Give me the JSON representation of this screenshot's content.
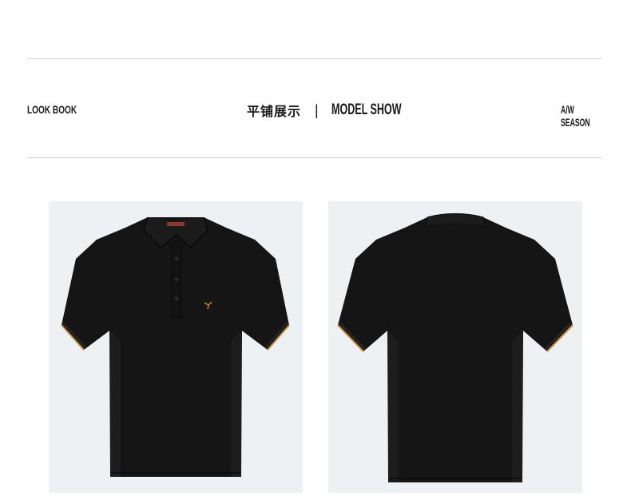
{
  "header": {
    "left_label": "LOOK BOOK",
    "center_label_zh": "平铺展示",
    "separator": "|",
    "center_label_en": "MODEL SHOW",
    "right_label": "A/W SEASON"
  },
  "gallery": {
    "items": [
      {
        "view": "front",
        "garment": "black polo shirt"
      },
      {
        "view": "back",
        "garment": "black polo shirt"
      }
    ]
  },
  "colors": {
    "background": "#ffffff",
    "rule": "#cfcfcf",
    "text": "#1a1a1a",
    "photo_bg": "#eef1f4",
    "shirt": "#151515",
    "trim_accent": "#c58a3b"
  }
}
